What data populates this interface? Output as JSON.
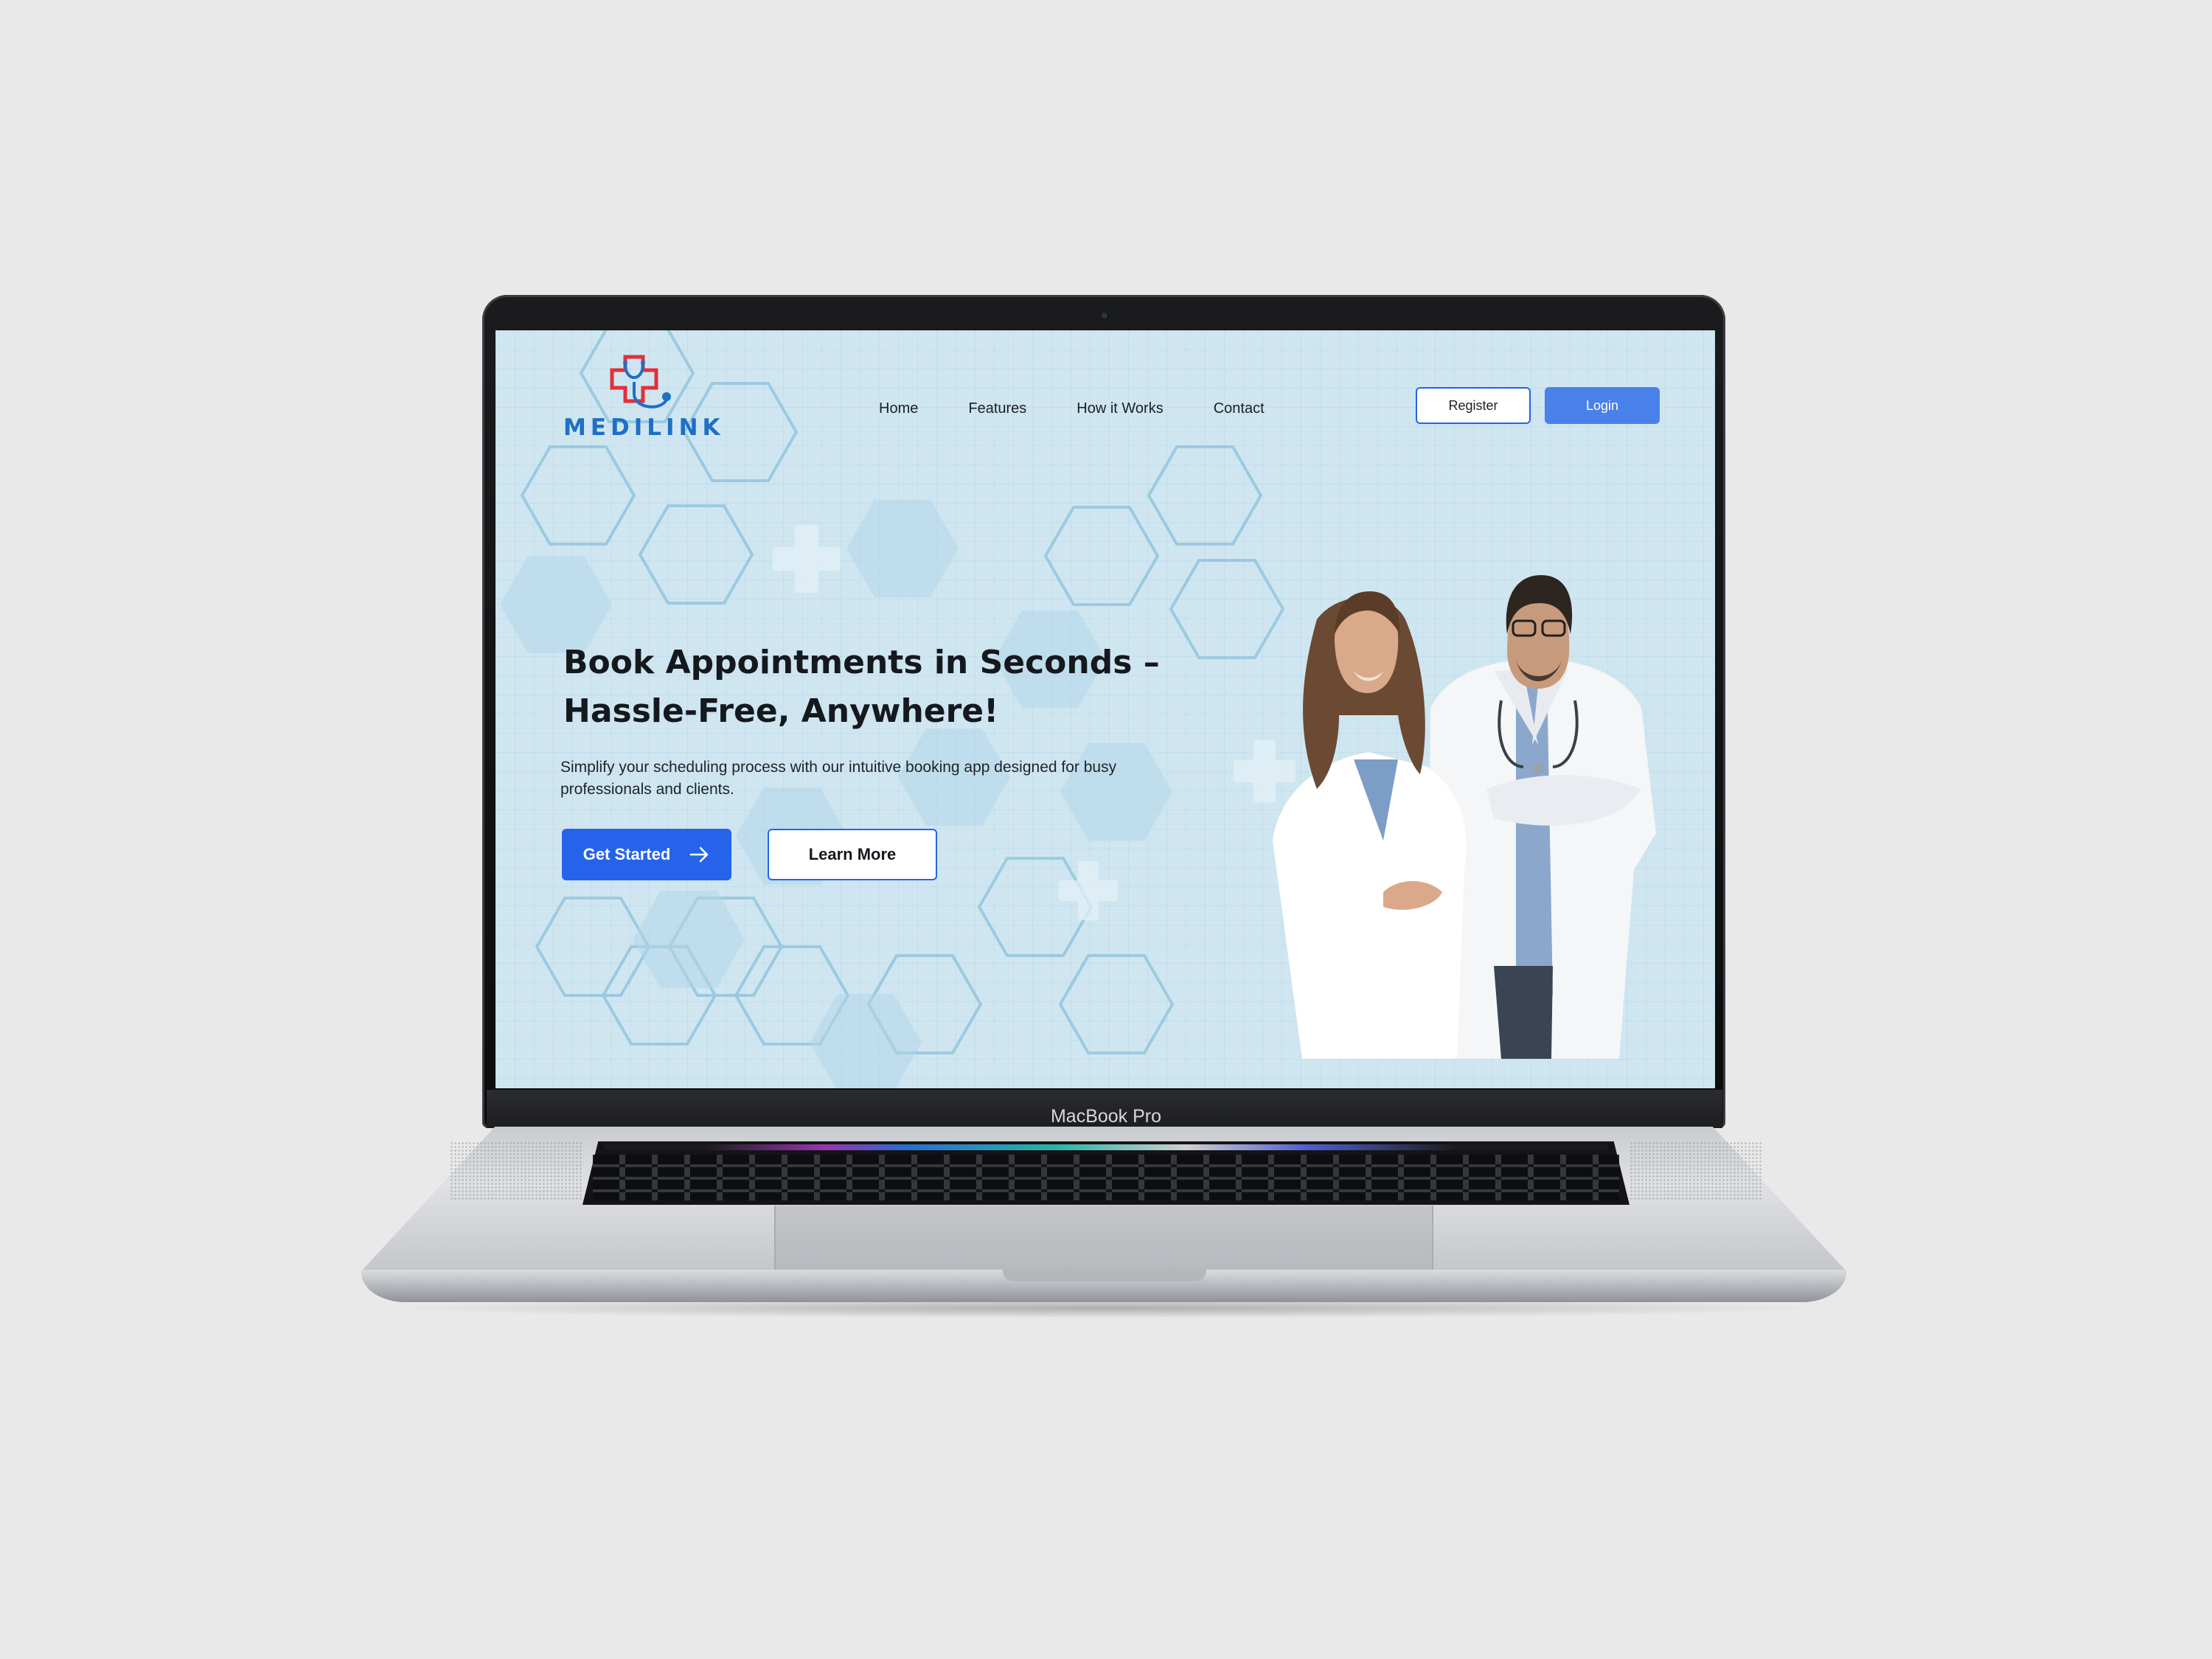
{
  "device": {
    "model_label": "MacBook Pro"
  },
  "site": {
    "brand": {
      "name": "MEDILINK",
      "logo_icon": "medical-cross-stethoscope-icon"
    },
    "nav": {
      "items": [
        {
          "label": "Home"
        },
        {
          "label": "Features"
        },
        {
          "label": "How it Works"
        },
        {
          "label": "Contact"
        }
      ]
    },
    "auth": {
      "register_label": "Register",
      "login_label": "Login"
    },
    "hero": {
      "title_line1": "Book Appointments in Seconds –",
      "title_line2": "Hassle-Free, Anywhere!",
      "subtitle_line1": "Simplify your scheduling process with our intuitive booking app designed for busy",
      "subtitle_line2": "professionals and clients.",
      "primary_cta": "Get Started",
      "primary_cta_icon": "arrow-right-icon",
      "secondary_cta": "Learn More",
      "image": "two-doctors-photo"
    },
    "colors": {
      "primary": "#2563eb",
      "login_button": "#4a80ea",
      "brand_blue": "#1e6fc5",
      "logo_red": "#e0313b",
      "background": "#cfe6f1"
    }
  }
}
